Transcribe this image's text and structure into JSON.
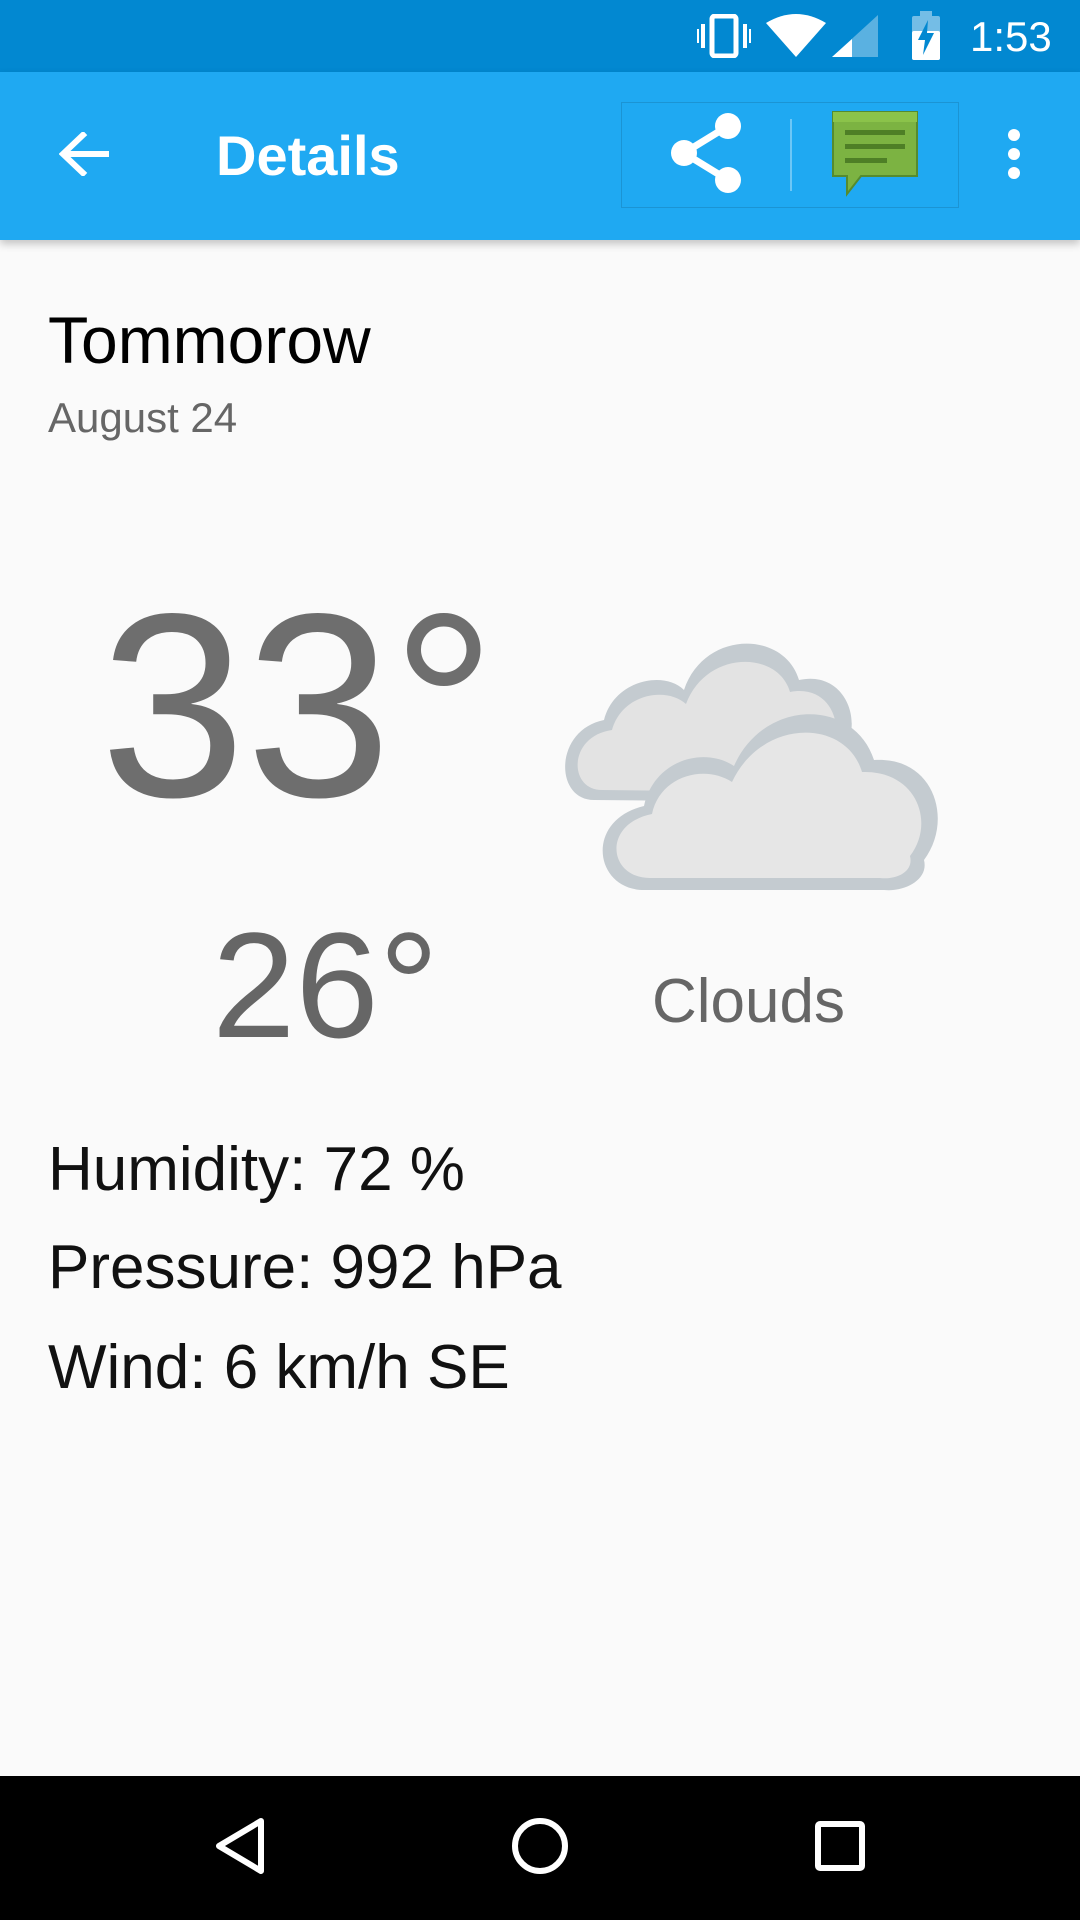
{
  "status_bar": {
    "time": "1:53",
    "icons": [
      "vibrate-icon",
      "wifi-icon",
      "cell-signal-icon",
      "battery-charging-icon"
    ]
  },
  "toolbar": {
    "title": "Details",
    "back_icon": "arrow-back-icon",
    "actions": [
      "share-icon",
      "message-icon",
      "more-vert-icon"
    ]
  },
  "forecast": {
    "day": "Tommorow",
    "date": "August 24",
    "high": "33°",
    "low": "26°",
    "condition": "Clouds",
    "condition_icon": "clouds-icon",
    "humidity": "Humidity: 72 %",
    "pressure": "Pressure: 992 hPa",
    "wind": "Wind: 6 km/h SE"
  },
  "nav_bar": {
    "buttons": [
      "nav-back-icon",
      "nav-home-icon",
      "nav-recents-icon"
    ]
  },
  "colors": {
    "status_bar": "#0288D1",
    "toolbar": "#1FA9F2",
    "background": "#FAFAFA",
    "temperature_text": "#6E6E6E",
    "message_icon": "#7CB342"
  }
}
